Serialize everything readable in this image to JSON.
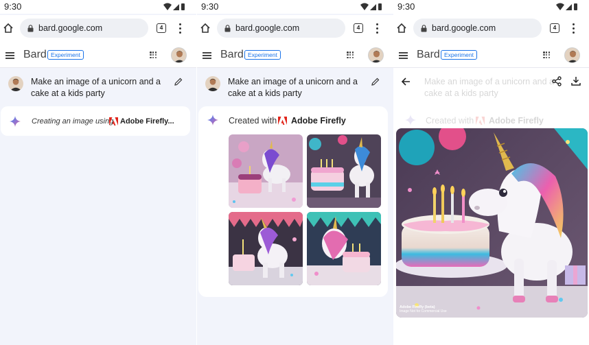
{
  "status_time": "9:30",
  "browser": {
    "url": "bard.google.com",
    "tab_count": "4"
  },
  "app": {
    "brand": "Bard",
    "badge": "Experiment"
  },
  "prompt": {
    "text": "Make an image of a unicorn and a cake at a kids party"
  },
  "panel1": {
    "creating_text": "Creating an image using",
    "brand_name": "Adobe Firefly..."
  },
  "panel2": {
    "created_text": "Created with",
    "brand_name": "Adobe Firefly"
  },
  "panel3": {
    "created_text": "Created with",
    "brand_name": "Adobe Firefly",
    "watermark_title": "Adobe Firefly (beta)",
    "watermark_sub": "Image Not for Commercial Use"
  },
  "icons": [
    "home-icon",
    "lock-icon",
    "tabs-icon",
    "more-icon",
    "menu-icon",
    "apps-icon",
    "edit-icon",
    "sparkle-icon",
    "adobe-firefly-logo",
    "back-arrow-icon",
    "share-icon",
    "download-icon",
    "wifi-icon",
    "signal-icon",
    "battery-icon"
  ],
  "colors": {
    "accent": "#1a73e8",
    "adobe_red": "#e1251b",
    "panel_bg": "#f2f4fb",
    "card_bg": "#ffffff"
  }
}
